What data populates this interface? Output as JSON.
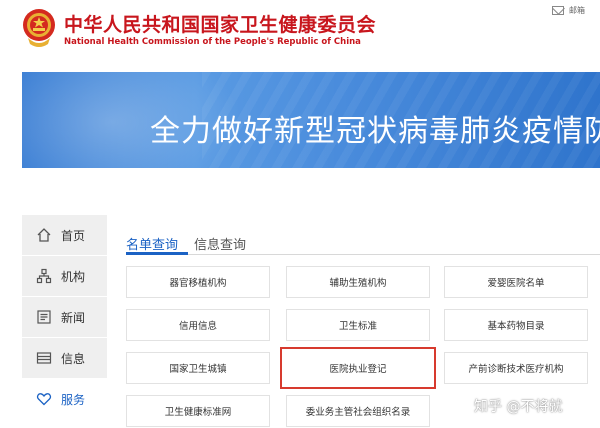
{
  "header": {
    "title_cn": "中华人民共和国国家卫生健康委员会",
    "title_en": "National Health Commission of the People's Republic of China",
    "mail_label": "邮箱"
  },
  "banner": {
    "text": "全力做好新型冠状病毒肺炎疫情防控"
  },
  "sidebar": {
    "items": [
      {
        "label": "首页",
        "icon": "home-icon",
        "active": false
      },
      {
        "label": "机构",
        "icon": "org-icon",
        "active": false
      },
      {
        "label": "新闻",
        "icon": "news-icon",
        "active": false
      },
      {
        "label": "信息",
        "icon": "info-icon",
        "active": false
      },
      {
        "label": "服务",
        "icon": "heart-icon",
        "active": true
      }
    ]
  },
  "tabs": [
    {
      "label": "名单查询",
      "active": true
    },
    {
      "label": "信息查询",
      "active": false
    }
  ],
  "grid": {
    "cells": [
      [
        "器官移植机构",
        "辅助生殖机构",
        "爱婴医院名单"
      ],
      [
        "信用信息",
        "卫生标准",
        "基本药物目录"
      ],
      [
        "国家卫生城镇",
        "医院执业登记",
        "产前诊断技术医疗机构"
      ],
      [
        "卫生健康标准网",
        "委业务主管社会组织名录",
        ""
      ]
    ],
    "highlighted": "医院执业登记"
  },
  "watermark": "知乎 @不将就",
  "colors": {
    "brand_red": "#c8161d",
    "accent_blue": "#1b62c4",
    "highlight_red": "#d73a2e"
  }
}
